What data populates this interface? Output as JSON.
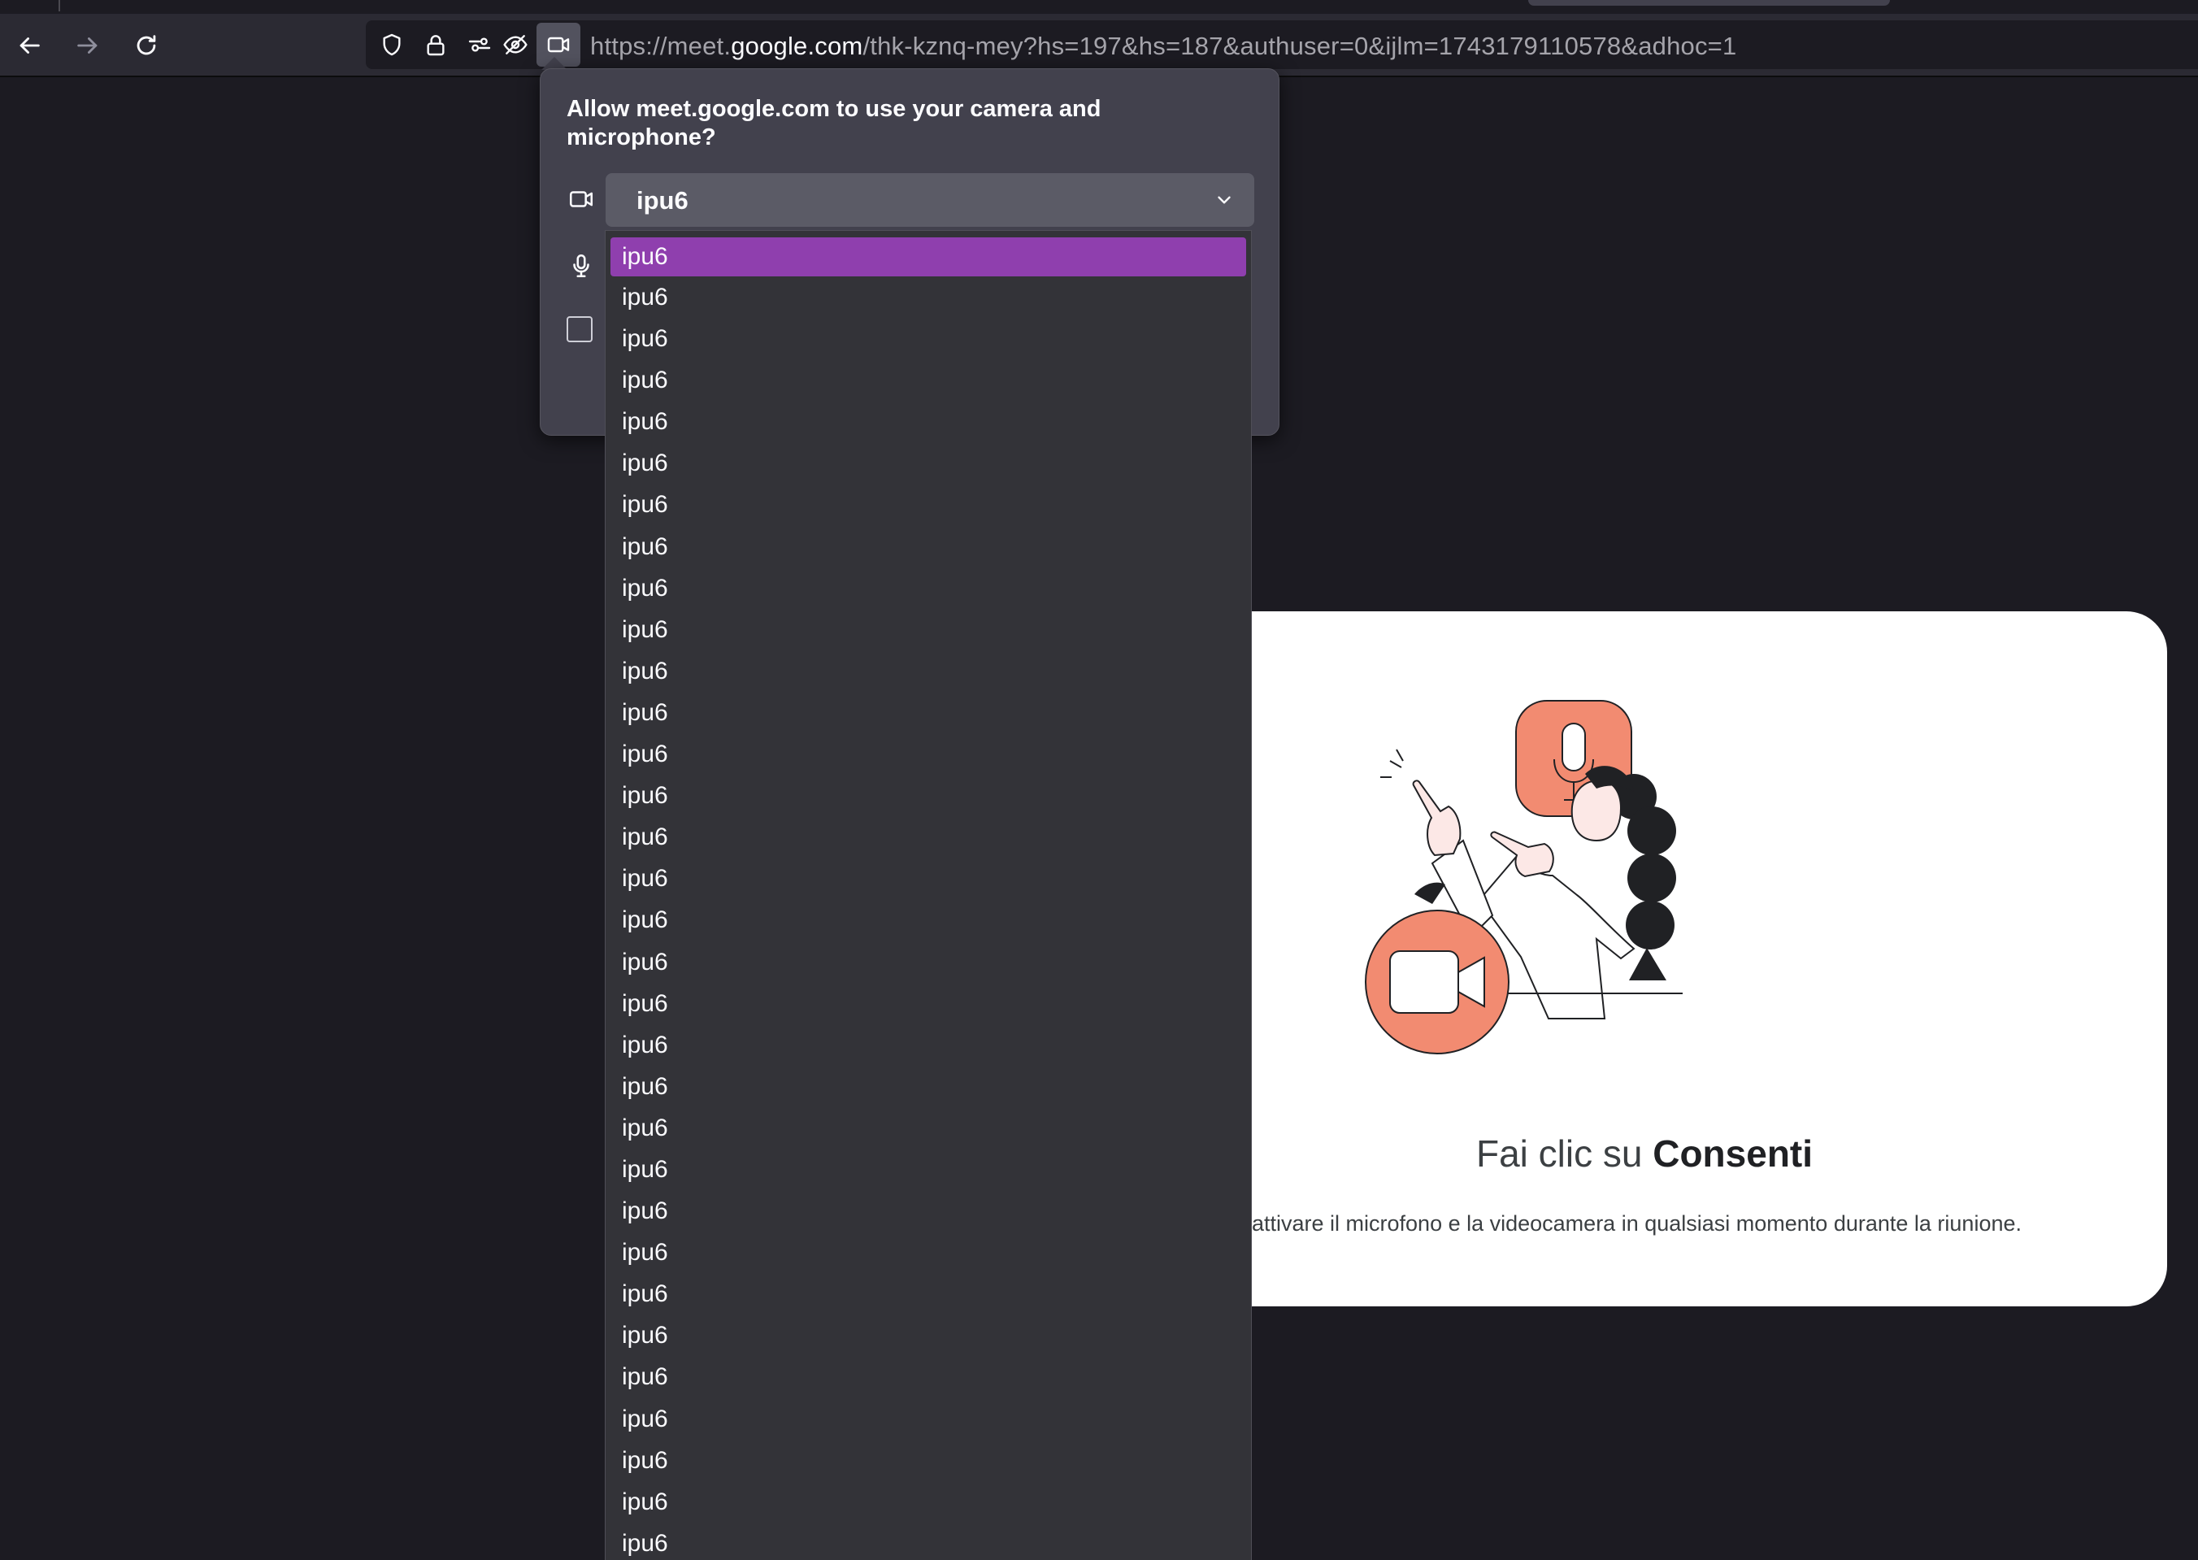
{
  "browser": {
    "url": {
      "prefix": "https://meet.",
      "host": "google.com",
      "path": "/thk-kznq-mey?hs=197&hs=187&authuser=0&ijlm=1743179110578&adhoc=1"
    },
    "icons": {
      "back": "back-arrow-icon",
      "forward": "forward-arrow-icon",
      "reload": "reload-icon",
      "tracking": "shield-icon",
      "secure": "lock-icon",
      "permissions": "permissions-icon",
      "blocked": "eye-blocked-icon",
      "camera": "camera-icon"
    }
  },
  "permission_panel": {
    "title": "Allow meet.google.com to use your camera and microphone?",
    "camera_select": {
      "selected": "ipu6"
    },
    "dropdown_options": [
      "ipu6",
      "ipu6",
      "ipu6",
      "ipu6",
      "ipu6",
      "ipu6",
      "ipu6",
      "ipu6",
      "ipu6",
      "ipu6",
      "ipu6",
      "ipu6",
      "ipu6",
      "ipu6",
      "ipu6",
      "ipu6",
      "ipu6",
      "ipu6",
      "ipu6",
      "ipu6",
      "ipu6",
      "ipu6",
      "ipu6",
      "ipu6",
      "ipu6",
      "ipu6",
      "ipu6",
      "ipu6",
      "ipu6",
      "ipu6",
      "ipu6",
      "ipu6"
    ],
    "selected_index": 0
  },
  "meet_card": {
    "title_regular": "Fai clic su ",
    "title_bold": "Consenti",
    "description": "attivare il microfono e la videocamera in qualsiasi momento durante la riunione.",
    "colors": {
      "accent": "#f28b71",
      "ink": "#202124"
    }
  }
}
